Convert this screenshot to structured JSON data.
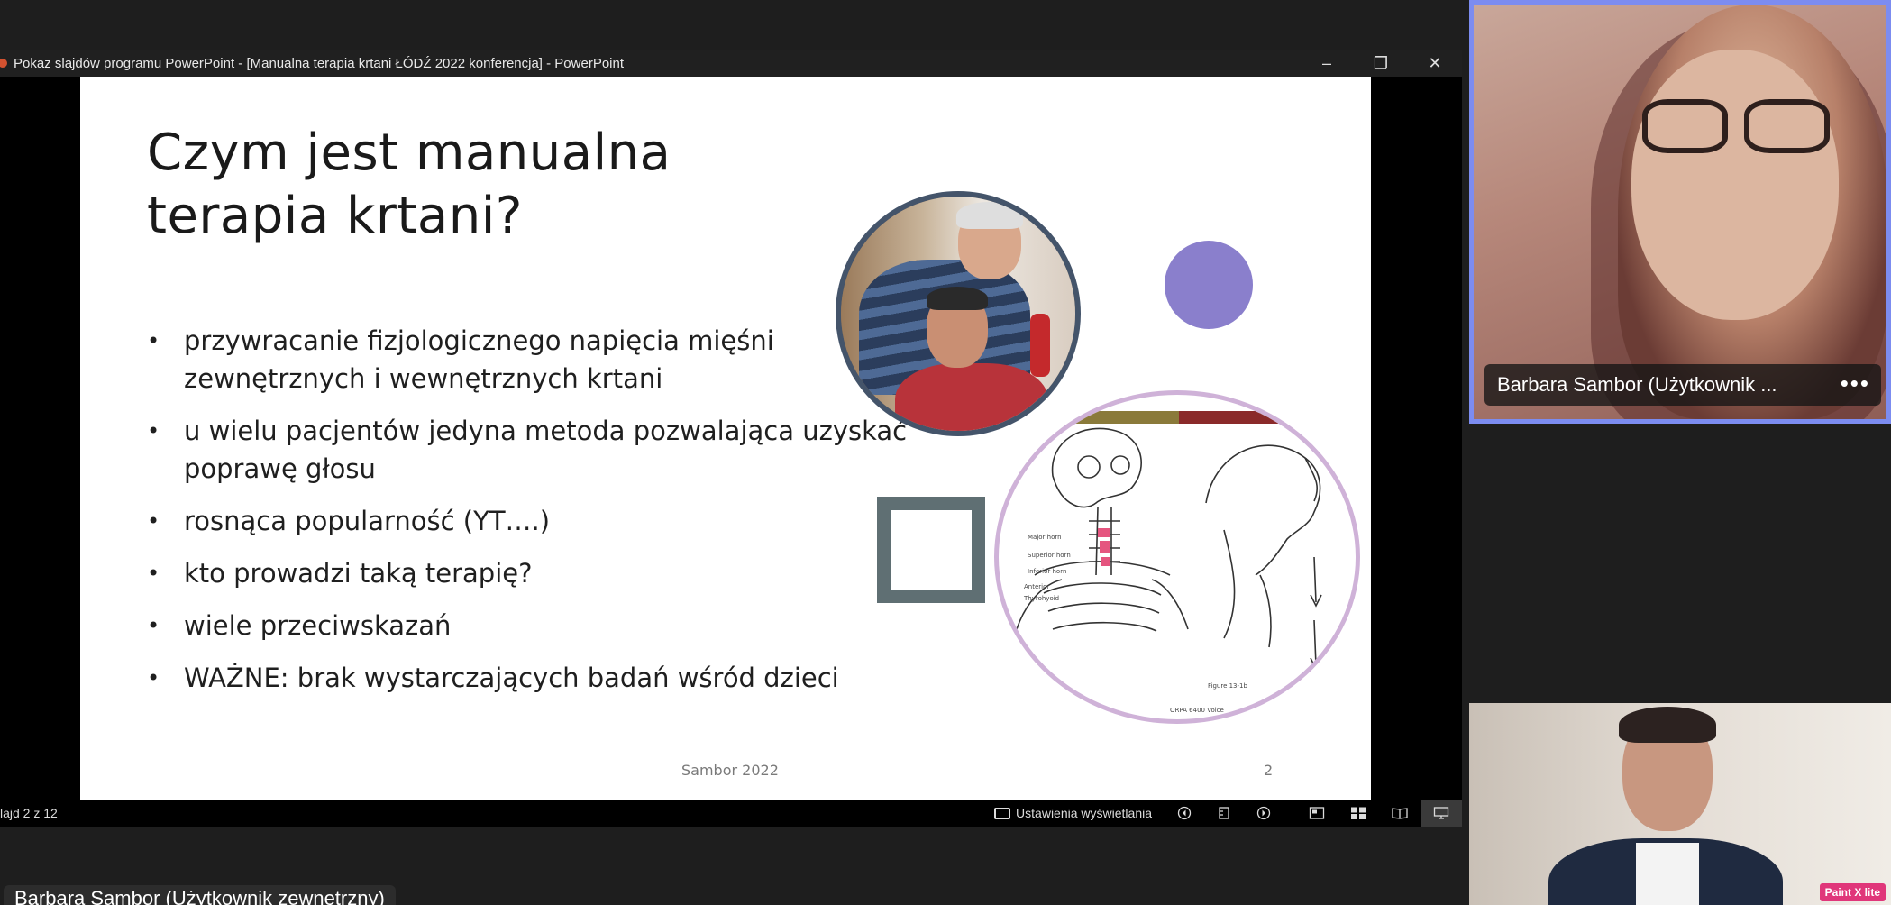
{
  "window": {
    "title": "Pokaz slajdów programu PowerPoint - [Manualna terapia krtani ŁÓDŹ 2022 konferencja] - PowerPoint",
    "controls": {
      "minimize": "–",
      "restore": "❐",
      "close": "✕"
    }
  },
  "slide": {
    "title_line1": "Czym jest manualna",
    "title_line2": "terapia krtani?",
    "bullets": [
      "przywracanie fizjologicznego napięcia mięśni zewnętrznych i wewnętrznych krtani",
      "u wielu pacjentów jedyna metoda pozwalająca uzyskać poprawę głosu",
      "rosnąca popularność (YT….)",
      "kto prowadzi taką terapię?",
      "wiele przeciwskazań",
      "WAŻNE: brak wystarczających badań wśród dzieci"
    ],
    "footer": "Sambor 2022",
    "number": "2",
    "colors": {
      "purple_dot": "#8a7fcc",
      "square": "#5f6f73",
      "photo_ring": "#44546a",
      "anatomy_ring": "#cfb2d8"
    }
  },
  "status": {
    "slide_count": "lajd 2 z 12",
    "display_settings": "Ustawienia wyświetlania",
    "icons": [
      "prev-icon",
      "slide-sorter-icon",
      "next-icon",
      "normal-view-icon",
      "grid-view-icon",
      "reading-view-icon",
      "slideshow-view-icon"
    ]
  },
  "participants": {
    "top_name": "Barbara Sambor (Użytkownik ...",
    "more": "•••",
    "bottom_badge": "Paint X lite",
    "bottom_label": "Barbara Sambor (Użytkownik zewnętrzny)"
  },
  "accent": "#7c8cf0"
}
